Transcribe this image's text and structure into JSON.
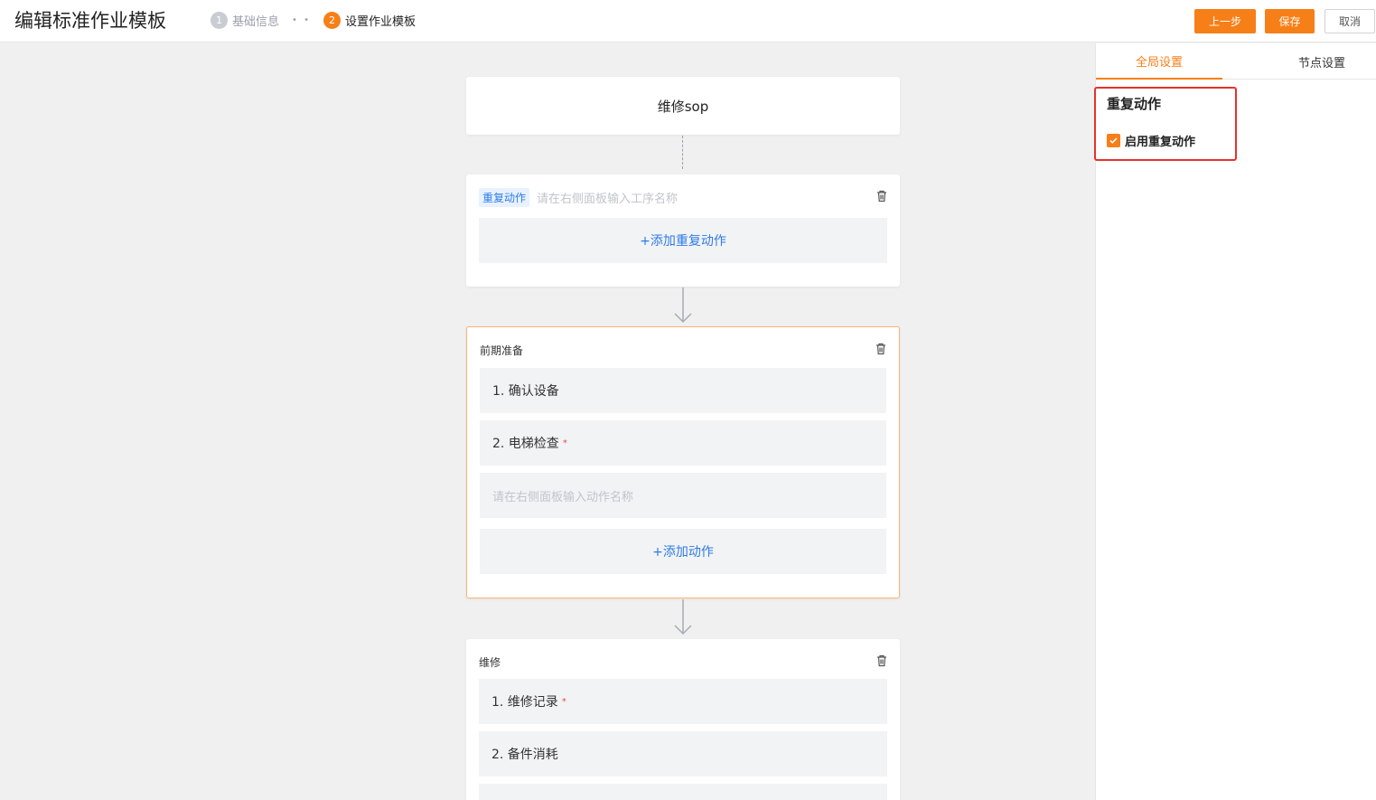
{
  "header": {
    "title": "编辑标准作业模板",
    "steps": [
      {
        "num": "1",
        "label": "基础信息",
        "state": "done"
      },
      {
        "num": "2",
        "label": "设置作业模板",
        "state": "active"
      }
    ],
    "step_separator": "• •",
    "buttons": {
      "prev": "上一步",
      "save": "保存",
      "cancel": "取消"
    }
  },
  "flow": {
    "root_title": "维修sop",
    "repeat_node": {
      "tag": "重复动作",
      "name_placeholder": "请在右侧面板输入工序名称",
      "add_label": "+添加重复动作"
    },
    "prep_node": {
      "title": "前期准备",
      "actions": [
        {
          "label": "1. 确认设备",
          "required": false
        },
        {
          "label": "2. 电梯检查",
          "required": true
        }
      ],
      "action_placeholder": "请在右侧面板输入动作名称",
      "add_label": "+添加动作"
    },
    "repair_node": {
      "title": "维修",
      "actions": [
        {
          "label": "1. 维修记录",
          "required": true
        },
        {
          "label": "2. 备件消耗",
          "required": false
        }
      ]
    },
    "required_mark": "*"
  },
  "panel": {
    "tabs": [
      {
        "label": "全局设置",
        "active": true
      },
      {
        "label": "节点设置",
        "active": false
      }
    ],
    "section_title": "重复动作",
    "checkbox_label": "启用重复动作",
    "checkbox_checked": true
  },
  "colors": {
    "accent": "#f77f17",
    "link": "#2f7be5",
    "highlight": "#e5322b",
    "required": "#f04a4a"
  }
}
